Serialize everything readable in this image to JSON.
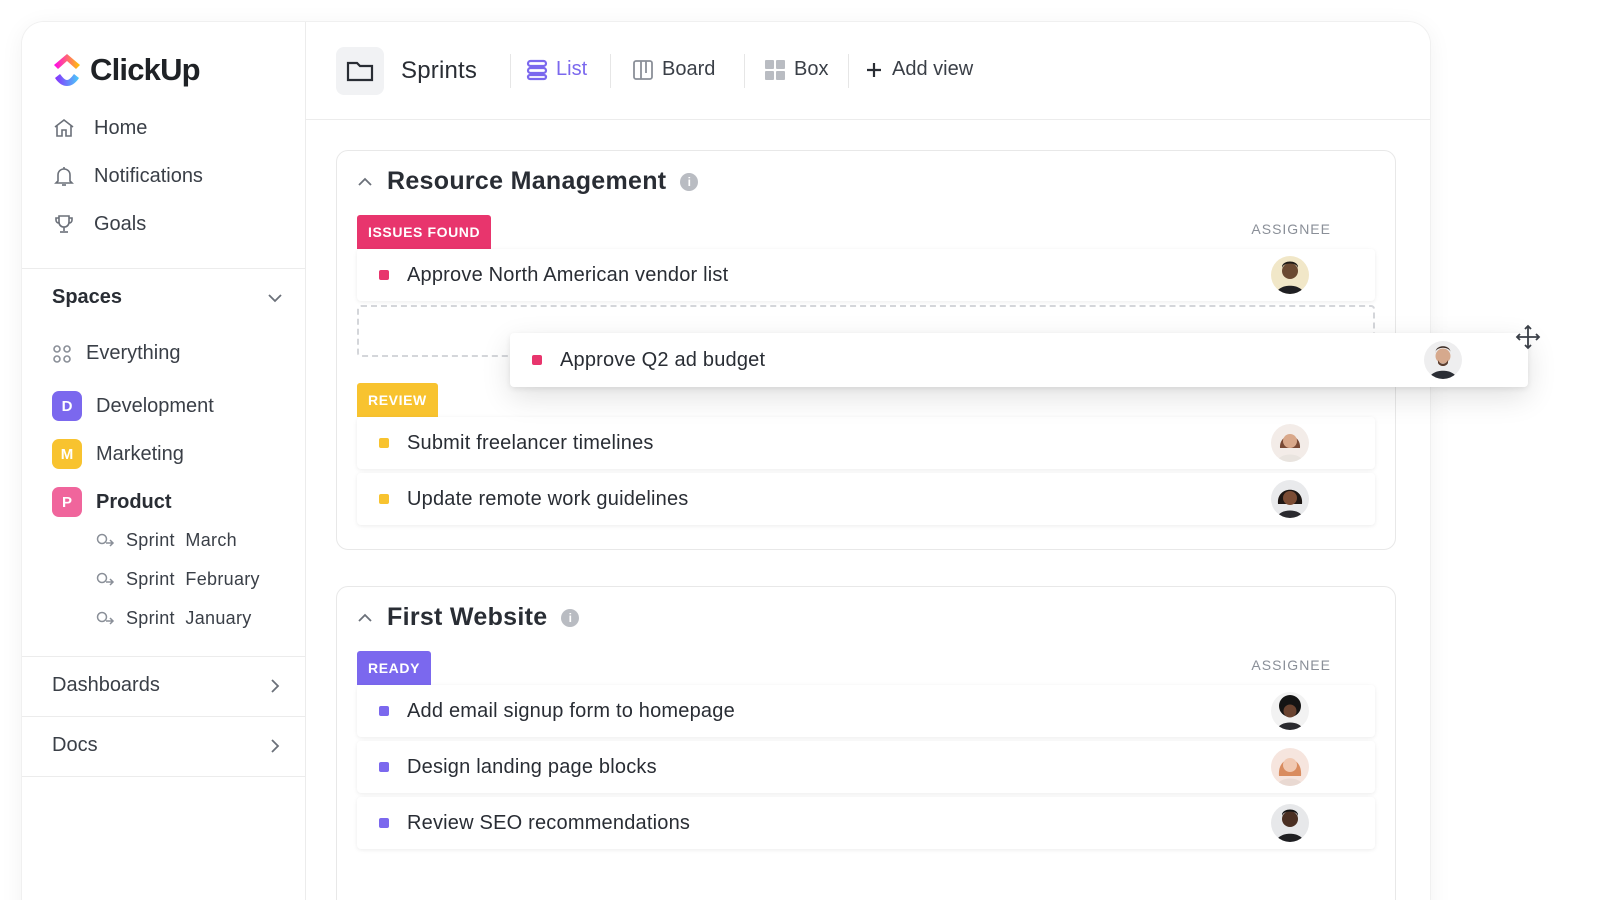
{
  "app": {
    "name": "ClickUp"
  },
  "colors": {
    "accent": "#7b68ee",
    "issues": "#e8356d",
    "review": "#f8c32f",
    "ready": "#7b68ee"
  },
  "sidebar": {
    "nav": [
      {
        "label": "Home",
        "icon": "home-icon"
      },
      {
        "label": "Notifications",
        "icon": "bell-icon"
      },
      {
        "label": "Goals",
        "icon": "trophy-icon"
      }
    ],
    "spaces_label": "Spaces",
    "everything_label": "Everything",
    "spaces": [
      {
        "letter": "D",
        "label": "Development",
        "color": "#7b68ee"
      },
      {
        "letter": "M",
        "label": "Marketing",
        "color": "#f8c32f"
      },
      {
        "letter": "P",
        "label": "Product",
        "color": "#f0659c"
      }
    ],
    "sprints": [
      "Sprint  March",
      "Sprint  February",
      "Sprint  January"
    ],
    "dashboards_label": "Dashboards",
    "docs_label": "Docs"
  },
  "header": {
    "title": "Sprints",
    "views": [
      {
        "label": "List",
        "icon": "list-icon",
        "active": true
      },
      {
        "label": "Board",
        "icon": "board-icon"
      },
      {
        "label": "Box",
        "icon": "box-icon"
      },
      {
        "label": "Add view",
        "icon": "plus-icon"
      }
    ]
  },
  "groups": [
    {
      "title": "Resource Management",
      "assignee_label": "ASSIGNEE",
      "statuses": [
        {
          "label": "ISSUES FOUND",
          "tasks": [
            "Approve North American vendor list"
          ]
        },
        {
          "label": "REVIEW",
          "tasks": [
            "Submit freelancer timelines",
            "Update remote work guidelines"
          ]
        }
      ]
    },
    {
      "title": "First Website",
      "assignee_label": "ASSIGNEE",
      "statuses": [
        {
          "label": "READY",
          "tasks": [
            "Add email signup form to homepage",
            "Design landing page blocks",
            "Review SEO recommendations"
          ]
        }
      ]
    }
  ],
  "dragging_task": "Approve Q2 ad budget",
  "info_glyph": "i"
}
